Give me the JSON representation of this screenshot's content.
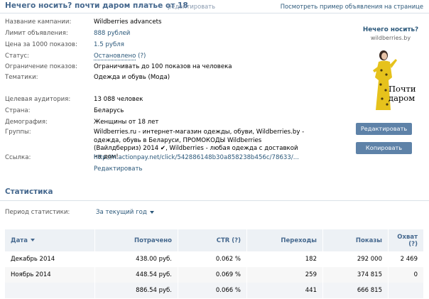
{
  "header": {
    "title": "Нечего носить? почти даром платье от 18",
    "edit_link": "редактировать",
    "preview_link": "Посмотреть пример объявления на странице"
  },
  "info": {
    "campaign_label": "Название кампании:",
    "campaign_value": "Wildberries advancets",
    "limit_label": "Лимит объявления:",
    "limit_value": "888 рублей",
    "price_label": "Цена за 1000 показов:",
    "price_value": "1.5 рубля",
    "status_label": "Статус:",
    "status_value": "Остановлено",
    "status_help": "(?)",
    "restriction_label": "Ограничение показов:",
    "restriction_value": "Ограничивать до 100 показов на человека",
    "topics_label": "Тематики:",
    "topics_value": "Одежда и обувь (Мода)",
    "audience_label": "Целевая аудитория:",
    "audience_value": "13 088 человек",
    "country_label": "Страна:",
    "country_value": "Беларусь",
    "demography_label": "Демография:",
    "demography_value": "Женщины от 18 лет",
    "groups_label": "Группы:",
    "groups_value": "Wildberries.ru - интернет-магазин одежды, обуви, Wildberries.by - одежда, обувь в Беларуси, ПРОМОКОДЫ Wildberries (Вайлдберриз) 2014 ✔, Wildberries - любая одежда с доставкой на дом!",
    "link_label": "Ссылка:",
    "link_value": "http://n.actionpay.net/click/542886148b30a858238b456c/78633/...",
    "link_edit": "Редактировать"
  },
  "ad": {
    "title": "Нечего носить?",
    "domain": "wildberries.by",
    "slogan_line1": "Почти",
    "slogan_line2": "даром!"
  },
  "buttons": {
    "edit": "Редактировать",
    "copy": "Копировать"
  },
  "stats": {
    "title": "Статистика",
    "period_label": "Период статистики:",
    "period_value": "За текущий год",
    "columns": [
      "Дата",
      "Потрачено",
      "CTR (?)",
      "Переходы",
      "Показы",
      "Охват (?)"
    ],
    "rows": [
      [
        "Декабрь 2014",
        "438.00 руб.",
        "0.062 %",
        "182",
        "292 000",
        "2 469"
      ],
      [
        "Ноябрь 2014",
        "448.54 руб.",
        "0.069 %",
        "259",
        "374 815",
        "0"
      ]
    ],
    "total": [
      "",
      "886.54 руб.",
      "0.066 %",
      "441",
      "666 815",
      ""
    ]
  },
  "colors": {
    "accent": "#45688e",
    "link": "#2b587a",
    "button": "#5e82a8",
    "table_header": "#edf1f5"
  }
}
